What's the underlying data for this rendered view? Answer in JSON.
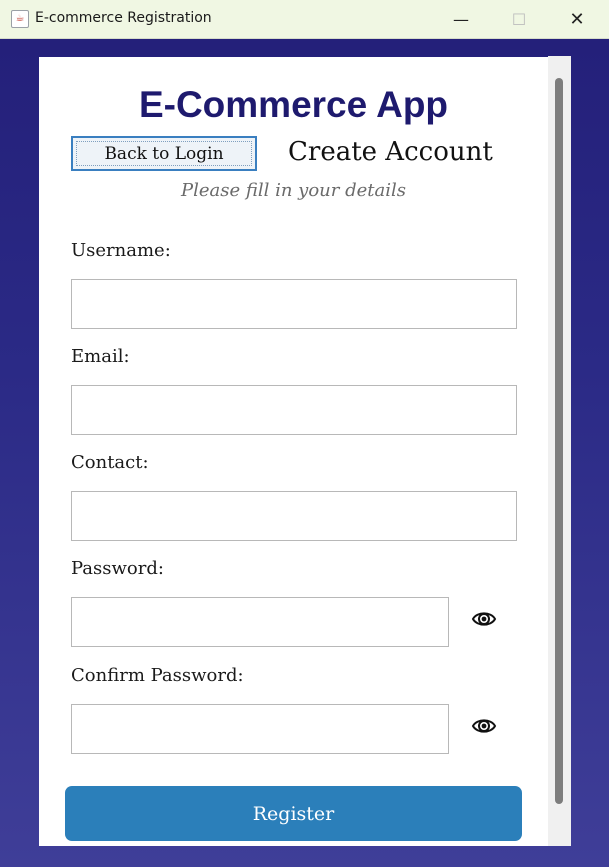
{
  "window": {
    "title": "E-commerce Registration",
    "controls": {
      "minimize": "—",
      "maximize": "☐",
      "close": "✕"
    }
  },
  "header": {
    "app_title": "E-Commerce App",
    "back_button": "Back to Login",
    "page_title": "Create Account",
    "subtitle": "Please fill in your details"
  },
  "form": {
    "username_label": "Username:",
    "username_value": "",
    "email_label": "Email:",
    "email_value": "",
    "contact_label": "Contact:",
    "contact_value": "",
    "password_label": "Password:",
    "password_value": "",
    "confirm_label": "Confirm Password:",
    "confirm_value": "",
    "register_button": "Register"
  },
  "icons": {
    "app": "java-cup-icon",
    "password_toggle": "eye-icon",
    "confirm_toggle": "eye-icon"
  },
  "colors": {
    "background_top": "#24207a",
    "background_bottom": "#3f3e98",
    "title": "#1e1a6e",
    "register_button": "#2b7fba",
    "back_button_border": "#3a7fc0"
  }
}
